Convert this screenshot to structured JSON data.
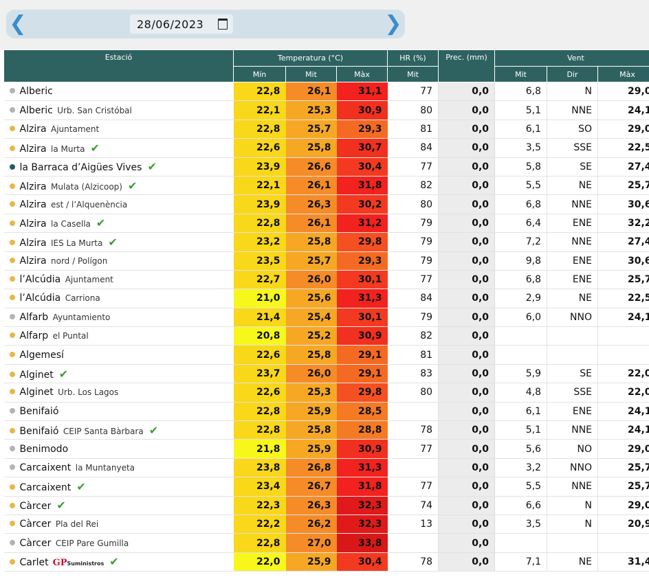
{
  "nav": {
    "date": "28/06/2023",
    "prev_icon": "chevron-left-icon",
    "next_icon": "chevron-right-icon"
  },
  "headers": {
    "station": "Estació",
    "temperature": "Temperatura (°C)",
    "hr": "HR (%)",
    "prec": "Prec. (mm)",
    "wind": "Vent",
    "min": "Mín",
    "mit": "Mit",
    "max": "Màx",
    "hr_mit": "Mit",
    "wind_mit": "Mit",
    "wind_dir": "Dir",
    "wind_max": "Màx"
  },
  "colors": {
    "header_bg": "#2e6260",
    "nav_bg": "#d2e1e9",
    "arrow": "#3b8dcb",
    "check": "#3a9c31",
    "dot_grey": "#b3b3b3",
    "dot_yellow": "#e8b64a",
    "dot_teal": "#1f5d5b"
  },
  "rows": [
    {
      "name": "Alberic",
      "sub": "",
      "check": false,
      "dot": "#b3b3b3",
      "min": "22,8",
      "min_c": "#f9d719",
      "mit": "26,1",
      "mit_c": "#f58c28",
      "max": "31,1",
      "max_c": "#f2221f",
      "hr": "77",
      "prec": "0,0",
      "wmit": "6,8",
      "wdir": "N",
      "wmax": "29,0"
    },
    {
      "name": "Alberic",
      "sub": "Urb. San Cristóbal",
      "check": false,
      "dot": "#b3b3b3",
      "min": "22,1",
      "min_c": "#f9d719",
      "mit": "25,3",
      "mit_c": "#f6a824",
      "max": "30,9",
      "max_c": "#f2301f",
      "hr": "80",
      "prec": "0,0",
      "wmit": "5,1",
      "wdir": "NNE",
      "wmax": "24,1"
    },
    {
      "name": "Alzira",
      "sub": "Ajuntament",
      "check": false,
      "dot": "#e8b64a",
      "min": "22,8",
      "min_c": "#f9d719",
      "mit": "25,7",
      "mit_c": "#f6a824",
      "max": "29,3",
      "max_c": "#f56a22",
      "hr": "81",
      "prec": "0,0",
      "wmit": "6,1",
      "wdir": "SO",
      "wmax": "29,0"
    },
    {
      "name": "Alzira",
      "sub": "la Murta",
      "check": true,
      "dot": "#e8b64a",
      "min": "22,6",
      "min_c": "#f9d719",
      "mit": "25,8",
      "mit_c": "#f6a824",
      "max": "30,7",
      "max_c": "#f2301f",
      "hr": "84",
      "prec": "0,0",
      "wmit": "3,5",
      "wdir": "SSE",
      "wmax": "22,5"
    },
    {
      "name": "la Barraca d’Aigües Vives",
      "sub": "",
      "check": true,
      "dot": "#1f5d5b",
      "min": "23,9",
      "min_c": "#f9d719",
      "mit": "26,6",
      "mit_c": "#f58c28",
      "max": "30,4",
      "max_c": "#f33a20",
      "hr": "77",
      "prec": "0,0",
      "wmit": "5,8",
      "wdir": "SE",
      "wmax": "27,4"
    },
    {
      "name": "Alzira",
      "sub": "Mulata (Alzicoop)",
      "check": true,
      "dot": "#e8b64a",
      "min": "22,1",
      "min_c": "#f9d719",
      "mit": "26,1",
      "mit_c": "#f58c28",
      "max": "31,8",
      "max_c": "#f2221f",
      "hr": "82",
      "prec": "0,0",
      "wmit": "5,5",
      "wdir": "NE",
      "wmax": "25,7"
    },
    {
      "name": "Alzira",
      "sub": "est / l’Alquenència",
      "check": false,
      "dot": "#e8b64a",
      "min": "23,9",
      "min_c": "#f9d719",
      "mit": "26,3",
      "mit_c": "#f58c28",
      "max": "30,2",
      "max_c": "#f33a20",
      "hr": "80",
      "prec": "0,0",
      "wmit": "6,8",
      "wdir": "NNE",
      "wmax": "30,6"
    },
    {
      "name": "Alzira",
      "sub": "la Casella",
      "check": true,
      "dot": "#e8b64a",
      "min": "22,8",
      "min_c": "#f9d719",
      "mit": "26,1",
      "mit_c": "#f58c28",
      "max": "31,2",
      "max_c": "#f2221f",
      "hr": "79",
      "prec": "0,0",
      "wmit": "6,4",
      "wdir": "ENE",
      "wmax": "32,2"
    },
    {
      "name": "Alzira",
      "sub": "IES La Murta",
      "check": true,
      "dot": "#e8b64a",
      "min": "23,2",
      "min_c": "#f9d719",
      "mit": "25,8",
      "mit_c": "#f6a824",
      "max": "29,8",
      "max_c": "#f55022",
      "hr": "79",
      "prec": "0,0",
      "wmit": "7,2",
      "wdir": "NNE",
      "wmax": "27,4"
    },
    {
      "name": "Alzira",
      "sub": "nord / Polígon",
      "check": false,
      "dot": "#e8b64a",
      "min": "23,5",
      "min_c": "#f9d719",
      "mit": "25,7",
      "mit_c": "#f6a824",
      "max": "29,3",
      "max_c": "#f56a22",
      "hr": "79",
      "prec": "0,0",
      "wmit": "9,8",
      "wdir": "ENE",
      "wmax": "30,6"
    },
    {
      "name": "l’Alcúdia",
      "sub": "Ajuntament",
      "check": false,
      "dot": "#e8b64a",
      "min": "22,7",
      "min_c": "#f9d719",
      "mit": "26,0",
      "mit_c": "#f58c28",
      "max": "30,1",
      "max_c": "#f33a20",
      "hr": "77",
      "prec": "0,0",
      "wmit": "6,8",
      "wdir": "ENE",
      "wmax": "25,7"
    },
    {
      "name": "l’Alcúdia",
      "sub": "Carriona",
      "check": false,
      "dot": "#e8b64a",
      "min": "21,0",
      "min_c": "#f7f71c",
      "mit": "25,6",
      "mit_c": "#f6a824",
      "max": "31,3",
      "max_c": "#f2221f",
      "hr": "84",
      "prec": "0,0",
      "wmit": "2,9",
      "wdir": "NE",
      "wmax": "22,5"
    },
    {
      "name": "Alfarb",
      "sub": "Ayuntamiento",
      "check": false,
      "dot": "#b3b3b3",
      "min": "21,4",
      "min_c": "#f9d719",
      "mit": "25,4",
      "mit_c": "#f6a824",
      "max": "30,1",
      "max_c": "#f33a20",
      "hr": "79",
      "prec": "0,0",
      "wmit": "6,0",
      "wdir": "NNO",
      "wmax": "24,1"
    },
    {
      "name": "Alfarp",
      "sub": "el Puntal",
      "check": false,
      "dot": "#e8b64a",
      "min": "20,8",
      "min_c": "#f7f71c",
      "mit": "25,2",
      "mit_c": "#f6a824",
      "max": "30,9",
      "max_c": "#f2301f",
      "hr": "82",
      "prec": "0,0",
      "wmit": "",
      "wdir": "",
      "wmax": ""
    },
    {
      "name": "Algemesí",
      "sub": "",
      "check": false,
      "dot": "#e8b64a",
      "min": "22,6",
      "min_c": "#f9d719",
      "mit": "25,8",
      "mit_c": "#f6a824",
      "max": "29,1",
      "max_c": "#f56a22",
      "hr": "81",
      "prec": "0,0",
      "wmit": "",
      "wdir": "",
      "wmax": ""
    },
    {
      "name": "Alginet",
      "sub": "",
      "check": true,
      "dot": "#e8b64a",
      "min": "23,7",
      "min_c": "#f9d719",
      "mit": "26,0",
      "mit_c": "#f58c28",
      "max": "29,1",
      "max_c": "#f56a22",
      "hr": "83",
      "prec": "0,0",
      "wmit": "5,9",
      "wdir": "SE",
      "wmax": "22,0"
    },
    {
      "name": "Alginet",
      "sub": "Urb. Los Lagos",
      "check": false,
      "dot": "#e8b64a",
      "min": "22,6",
      "min_c": "#f9d719",
      "mit": "25,3",
      "mit_c": "#f6a824",
      "max": "29,8",
      "max_c": "#f55022",
      "hr": "80",
      "prec": "0,0",
      "wmit": "4,8",
      "wdir": "SSE",
      "wmax": "22,0"
    },
    {
      "name": "Benifaió",
      "sub": "",
      "check": false,
      "dot": "#b3b3b3",
      "min": "22,8",
      "min_c": "#f9d719",
      "mit": "25,9",
      "mit_c": "#f6a824",
      "max": "28,5",
      "max_c": "#f57a24",
      "hr": "",
      "prec": "0,0",
      "wmit": "6,1",
      "wdir": "ENE",
      "wmax": "24,1"
    },
    {
      "name": "Benifaió",
      "sub": "CEIP Santa Bàrbara",
      "check": true,
      "dot": "#e8b64a",
      "min": "22,8",
      "min_c": "#f9d719",
      "mit": "25,8",
      "mit_c": "#f6a824",
      "max": "28,8",
      "max_c": "#f57a24",
      "hr": "78",
      "prec": "0,0",
      "wmit": "5,1",
      "wdir": "NNE",
      "wmax": "24,1"
    },
    {
      "name": "Benimodo",
      "sub": "",
      "check": false,
      "dot": "#b3b3b3",
      "min": "21,8",
      "min_c": "#f7f71c",
      "mit": "25,9",
      "mit_c": "#f6a824",
      "max": "30,9",
      "max_c": "#f2301f",
      "hr": "77",
      "prec": "0,0",
      "wmit": "5,6",
      "wdir": "NO",
      "wmax": "29,0"
    },
    {
      "name": "Carcaixent",
      "sub": "la Muntanyeta",
      "check": false,
      "dot": "#b3b3b3",
      "min": "23,8",
      "min_c": "#f9d719",
      "mit": "26,8",
      "mit_c": "#f58c28",
      "max": "31,3",
      "max_c": "#f2221f",
      "hr": "",
      "prec": "0,0",
      "wmit": "3,2",
      "wdir": "NNO",
      "wmax": "25,7"
    },
    {
      "name": "Carcaixent",
      "sub": "",
      "check": true,
      "dot": "#e8b64a",
      "min": "23,4",
      "min_c": "#f9d719",
      "mit": "26,7",
      "mit_c": "#f58c28",
      "max": "31,8",
      "max_c": "#f2221f",
      "hr": "77",
      "prec": "0,0",
      "wmit": "5,5",
      "wdir": "NNE",
      "wmax": "25,7"
    },
    {
      "name": "Càrcer",
      "sub": "",
      "check": true,
      "dot": "#e8b64a",
      "min": "22,3",
      "min_c": "#f9d719",
      "mit": "26,3",
      "mit_c": "#f58c28",
      "max": "32,3",
      "max_c": "#e01a1a",
      "hr": "74",
      "prec": "0,0",
      "wmit": "6,6",
      "wdir": "N",
      "wmax": "29,0"
    },
    {
      "name": "Càrcer",
      "sub": "Pla del Rei",
      "check": false,
      "dot": "#e8b64a",
      "min": "22,2",
      "min_c": "#f9d719",
      "mit": "26,2",
      "mit_c": "#f58c28",
      "max": "32,3",
      "max_c": "#e01a1a",
      "hr": "13",
      "prec": "0,0",
      "wmit": "3,5",
      "wdir": "N",
      "wmax": "20,9"
    },
    {
      "name": "Càrcer",
      "sub": "CEIP Pare Gumilla",
      "check": false,
      "dot": "#b3b3b3",
      "min": "22,8",
      "min_c": "#f9d719",
      "mit": "27,0",
      "mit_c": "#f58c28",
      "max": "33,8",
      "max_c": "#d81818",
      "hr": "",
      "prec": "0,0",
      "wmit": "",
      "wdir": "",
      "wmax": ""
    },
    {
      "name": "Carlet",
      "sub": "",
      "sponsor": "GP",
      "sponsor_small": "Suministros",
      "check": true,
      "dot": "#e8b64a",
      "min": "22,0",
      "min_c": "#f7f71c",
      "mit": "25,9",
      "mit_c": "#f6a824",
      "max": "30,4",
      "max_c": "#f33a20",
      "hr": "78",
      "prec": "0,0",
      "wmit": "7,1",
      "wdir": "NE",
      "wmax": "31,4"
    }
  ]
}
